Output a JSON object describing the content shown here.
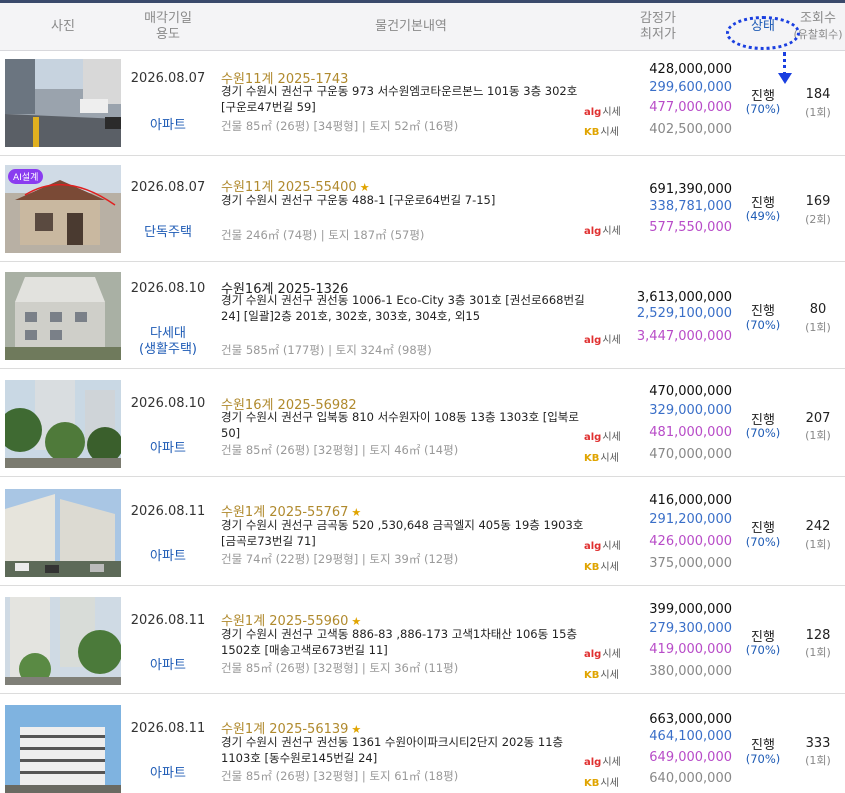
{
  "header": {
    "photo": "사진",
    "date_line1": "매각기일",
    "date_line2": "용도",
    "basic_info": "물건기본내역",
    "price_line1": "감정가",
    "price_line2": "최저가",
    "status": "상태",
    "views_line1": "조회수",
    "views_line2": "(유찰회수)"
  },
  "logos": {
    "alg_brand": "alg",
    "alg_suffix": "시세",
    "kb_brand": "KB",
    "kb_suffix": "시세"
  },
  "ai_badge": "AI설계",
  "items": [
    {
      "date": "2026.08.07",
      "usage": "아파트",
      "case": "수원11계 2025-1743",
      "address": "경기 수원시 권선구 구운동 973 서수원엠코타운르본느 101동 3층 302호 [구운로47번길 59]",
      "area": "건물 85㎡ (26평) [34평형]  |  토지 52㎡ (16평)",
      "appraisal": "428,000,000",
      "minimum": "299,600,000",
      "alg": "477,000,000",
      "kb": "402,500,000",
      "status": "진행",
      "percent": "(70%)",
      "views": "184",
      "fails": "(1회)"
    },
    {
      "date": "2026.08.07",
      "usage": "단독주택",
      "case": "수원11계 2025-55400",
      "address": "경기 수원시 권선구 구운동 488-1 [구운로64번길 7-15]",
      "area": "건물 246㎡ (74평)  |  토지 187㎡ (57평)",
      "appraisal": "691,390,000",
      "minimum": "338,781,000",
      "alg": "577,550,000",
      "kb": "",
      "status": "진행",
      "percent": "(49%)",
      "views": "169",
      "fails": "(2회)"
    },
    {
      "date": "2026.08.10",
      "usage": "다세대",
      "usage2": "(생활주택)",
      "case": "수원16계 2025-1326",
      "address": "경기 수원시 권선구 권선동 1006-1 Eco-City 3층 301호 [권선로668번길 24] [일괄]2층 201호, 302호, 303호, 304호, 외15",
      "area": "건물 585㎡ (177평)  |  토지 324㎡ (98평)",
      "appraisal": "3,613,000,000",
      "minimum": "2,529,100,000",
      "alg": "3,447,000,000",
      "kb": "",
      "status": "진행",
      "percent": "(70%)",
      "views": "80",
      "fails": "(1회)"
    },
    {
      "date": "2026.08.10",
      "usage": "아파트",
      "case": "수원16계 2025-56982",
      "address": "경기 수원시 권선구 입북동 810 서수원자이 108동 13층 1303호 [입북로 50]",
      "area": "건물 85㎡ (26평) [32평형]  |  토지 46㎡ (14평)",
      "appraisal": "470,000,000",
      "minimum": "329,000,000",
      "alg": "481,000,000",
      "kb": "470,000,000",
      "status": "진행",
      "percent": "(70%)",
      "views": "207",
      "fails": "(1회)"
    },
    {
      "date": "2026.08.11",
      "usage": "아파트",
      "case": "수원1계 2025-55767",
      "address": "경기 수원시 권선구 금곡동 520 ,530,648 금곡엘지 405동 19층 1903호 [금곡로73번길 71]",
      "area": "건물 74㎡ (22평) [29평형]  |  토지 39㎡ (12평)",
      "appraisal": "416,000,000",
      "minimum": "291,200,000",
      "alg": "426,000,000",
      "kb": "375,000,000",
      "status": "진행",
      "percent": "(70%)",
      "views": "242",
      "fails": "(1회)"
    },
    {
      "date": "2026.08.11",
      "usage": "아파트",
      "case": "수원1계 2025-55960",
      "address": "경기 수원시 권선구 고색동 886-83 ,886-173 고색1차태산 106동 15층 1502호 [매송고색로673번길 11]",
      "area": "건물 85㎡ (26평) [32평형]  |  토지 36㎡ (11평)",
      "appraisal": "399,000,000",
      "minimum": "279,300,000",
      "alg": "419,000,000",
      "kb": "380,000,000",
      "status": "진행",
      "percent": "(70%)",
      "views": "128",
      "fails": "(1회)"
    },
    {
      "date": "2026.08.11",
      "usage": "아파트",
      "case": "수원1계 2025-56139",
      "address": "경기 수원시 권선구 권선동 1361 수원아이파크시티2단지 202동 11층 1103호 [동수원로145번길 24]",
      "area": "건물 85㎡ (26평) [32평형]  |  토지 61㎡ (18평)",
      "appraisal": "663,000,000",
      "minimum": "464,100,000",
      "alg": "649,000,000",
      "kb": "640,000,000",
      "status": "진행",
      "percent": "(70%)",
      "views": "333",
      "fails": "(1회)"
    }
  ]
}
